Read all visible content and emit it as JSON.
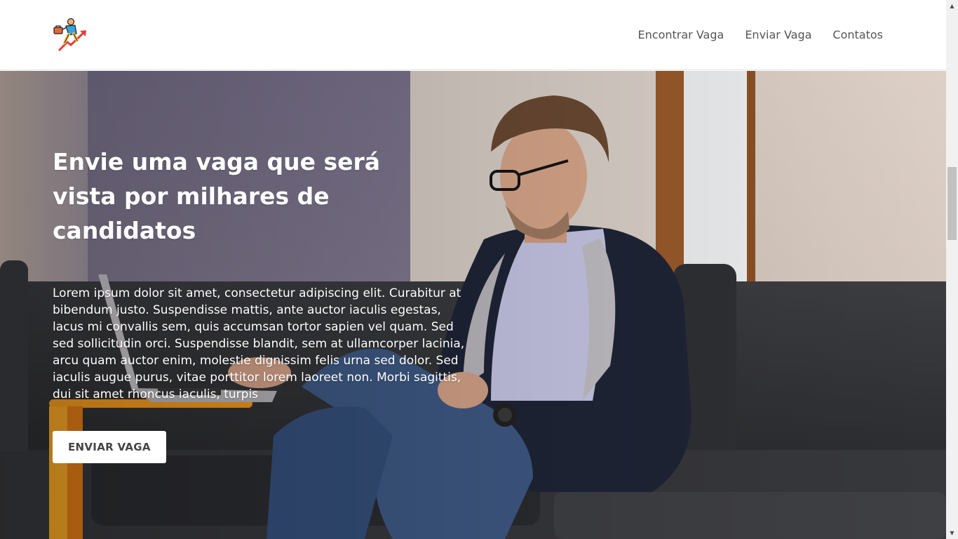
{
  "header": {
    "logo_icon": "climbing-worker-growth-arrow-icon",
    "nav": [
      {
        "label": "Encontrar Vaga"
      },
      {
        "label": "Enviar Vaga"
      },
      {
        "label": "Contatos"
      }
    ]
  },
  "hero": {
    "title": "Envie uma vaga que será vista por milhares de candidatos",
    "description": "Lorem ipsum dolor sit amet, consectetur adipiscing elit. Curabitur at bibendum justo. Suspendisse mattis, ante auctor iaculis egestas, lacus mi convallis sem, quis accumsan tortor sapien vel quam. Sed sed sollicitudin orci. Suspendisse blandit, sem at ullamcorper lacinia, arcu quam auctor enim, molestie dignissim felis urna sed dolor. Sed iaculis augue purus, vitae porttitor lorem laoreet non. Morbi sagittis, dui sit amet rhoncus iaculis, turpis",
    "button_label": "ENVIAR VAGA",
    "background": "photo-man-on-sofa-with-laptop"
  },
  "colors": {
    "header_bg": "#ffffff",
    "nav_text": "#555555",
    "hero_text": "#ffffff",
    "button_bg": "#ffffff",
    "button_text": "#444444"
  }
}
